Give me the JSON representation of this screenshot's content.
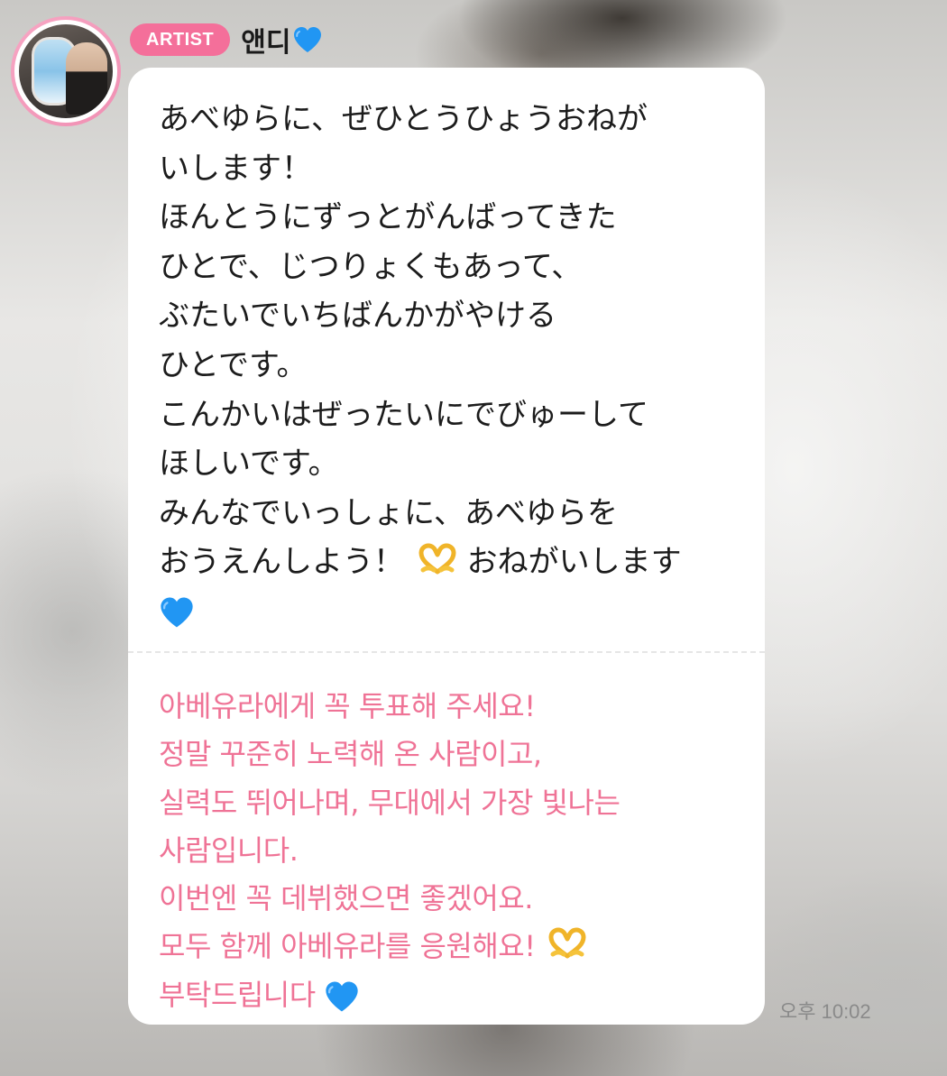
{
  "message": {
    "badge": "ARTIST",
    "sender_name": "앤디",
    "sender_icon": "blue-heart-icon",
    "japanese_lines": [
      "あべゆらに、ぜひとうひょうおねが",
      "いします！",
      "ほんとうにずっとがんばってきた",
      "ひとで、じつりょくもあって、",
      "ぶたいでいちばんかがやける",
      "ひとです。",
      "こんかいはぜったいにでびゅーして",
      "ほしいです。",
      "みんなでいっしょに、あべゆらを",
      "おうえんしよう！",
      "おねがいします"
    ],
    "korean_lines": [
      "아베유라에게 꼭 투표해 주세요!",
      "정말 꾸준히 노력해 온 사람이고,",
      "실력도 뛰어나며, 무대에서 가장 빛나는",
      "사람입니다.",
      "이번엔 꼭 데뷔했으면 좋겠어요.",
      "모두 함께 아베유라를 응원해요!",
      "부탁드립니다"
    ],
    "timestamp": "오후 10:02"
  },
  "colors": {
    "badge": "#f46f9a",
    "avatar_ring": "#f08fb3",
    "korean_text": "#ef7396",
    "blue_heart": "#2196f3",
    "hand_heart": "#f5c33b"
  }
}
